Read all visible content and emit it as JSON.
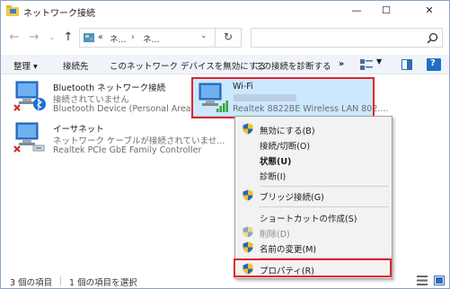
{
  "window": {
    "title": "ネットワーク接続",
    "minimize_icon": "minimize-icon",
    "maximize_icon": "maximize-icon",
    "close_icon": "close-icon"
  },
  "address": {
    "crumbs": [
      "«",
      "ネ...",
      "›",
      "ネ..."
    ],
    "search_placeholder": ""
  },
  "commands": {
    "organize": "整理 ▾",
    "connect_to": "接続先",
    "disable_device": "このネットワーク デバイスを無効にする",
    "diagnose": "この接続を診断する",
    "more": "»"
  },
  "items": [
    {
      "title": "Bluetooth ネットワーク接続",
      "line1": "接続されていません",
      "line2": "Bluetooth Device (Personal Area ..."
    },
    {
      "title": "Wi-Fi",
      "line1": "",
      "line2": "Realtek 8822BE Wireless LAN 802...."
    },
    {
      "title": "イーサネット",
      "line1": "ネットワーク ケーブルが接続されていませ...",
      "line2": "Realtek PCIe GbE Family Controller"
    }
  ],
  "context_menu": {
    "disable": "無効にする(B)",
    "connect_disconnect": "接続/切断(O)",
    "status": "状態(U)",
    "diagnose": "診断(I)",
    "bridge": "ブリッジ接続(G)",
    "create_shortcut": "ショートカットの作成(S)",
    "delete": "削除(D)",
    "rename": "名前の変更(M)",
    "properties": "プロパティ(R)"
  },
  "status": {
    "count": "3 個の項目",
    "selected": "1 個の項目を選択"
  },
  "colors": {
    "highlight_red": "#e0242c",
    "selection_bg": "#cce8ff",
    "selection_border": "#99d1ff",
    "cmdbar_bg": "#f0f4f9"
  }
}
